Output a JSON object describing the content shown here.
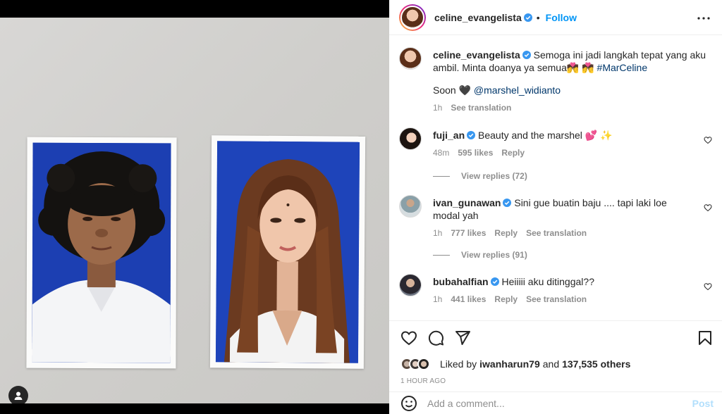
{
  "post": {
    "author": "celine_evangelista",
    "follow_label": "Follow",
    "caption": "Semoga ini jadi langkah tepat yang aku ambil. Minta doanya ya semua💏 💏",
    "hashtag": "#MarCeline",
    "caption_line2_prefix": "Soon 🖤",
    "mention": "@marshel_widianto",
    "time_ago": "1h",
    "see_translation": "See translation"
  },
  "comments": [
    {
      "user": "fuji_an",
      "text": "Beauty and the marshel 💕 ✨",
      "time": "48m",
      "likes": "595 likes",
      "reply": "Reply",
      "view_replies": "View replies (72)"
    },
    {
      "user": "ivan_gunawan",
      "text": "Sini gue buatin baju .... tapi laki loe modal yah",
      "time": "1h",
      "likes": "777 likes",
      "reply": "Reply",
      "translate": "See translation",
      "view_replies": "View replies (91)"
    },
    {
      "user": "bubahalfian",
      "text": "Heiiiii aku ditinggal??",
      "time": "1h",
      "likes": "441 likes",
      "reply": "Reply",
      "translate": "See translation"
    }
  ],
  "likes": {
    "prefix": "Liked by",
    "user": "iwanharun79",
    "and": "and",
    "others": "137,535 others"
  },
  "post_time": "1 HOUR AGO",
  "add_comment": {
    "placeholder": "Add a comment...",
    "post_label": "Post"
  },
  "icons": {
    "more": "more-horizontal-icon",
    "like": "heart-icon",
    "comment": "comment-icon",
    "share": "paper-plane-icon",
    "save": "bookmark-icon",
    "emoji": "smiley-icon",
    "tag": "user-tag-icon"
  },
  "colors": {
    "accent": "#0095f6",
    "link": "#00376b",
    "muted": "#8e8e8e",
    "verified": "#3897f0",
    "photo_bg": "#1d43b8"
  }
}
